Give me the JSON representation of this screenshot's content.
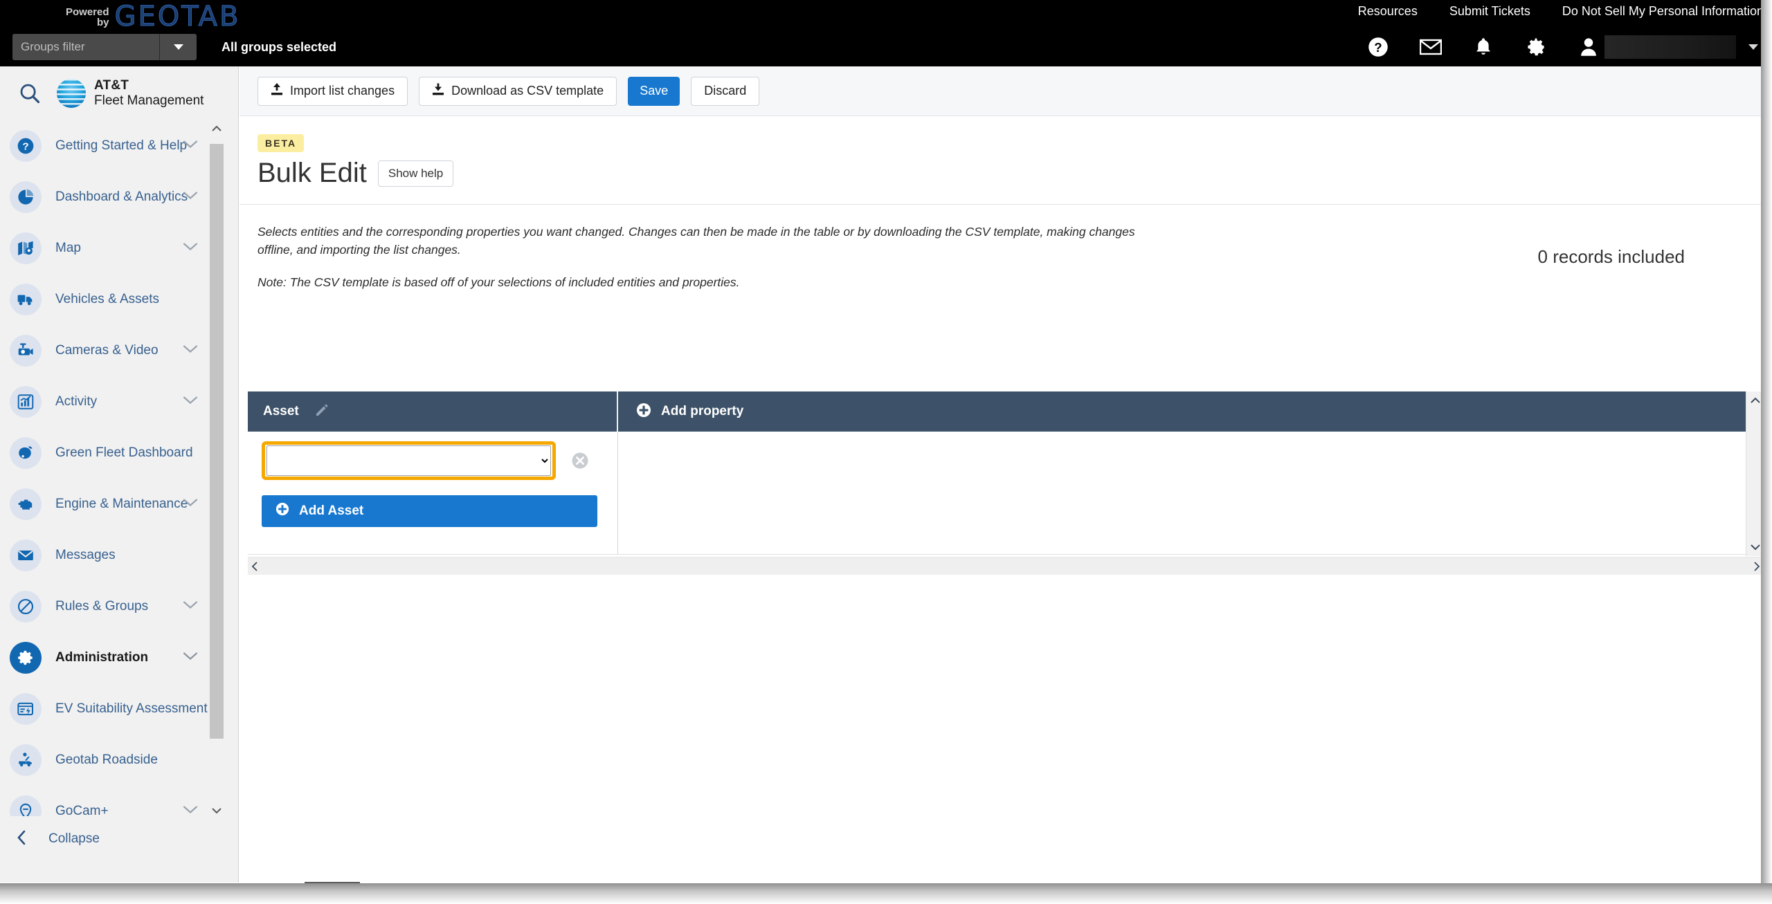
{
  "topbar": {
    "powered_line1": "Powered",
    "powered_line2": "by",
    "brand_word": "GEOTAB",
    "links": [
      {
        "label": "Resources",
        "name": "resources-link"
      },
      {
        "label": "Submit Tickets",
        "name": "submit-tickets-link"
      },
      {
        "label": "Do Not Sell My Personal Information",
        "name": "do-not-sell-link"
      }
    ],
    "groups_filter_placeholder": "Groups filter",
    "groups_filter_value": "",
    "all_groups_selected": "All groups selected",
    "icons": [
      "help-icon",
      "mail-icon",
      "bell-icon",
      "gear-icon",
      "user-icon"
    ]
  },
  "sidebar": {
    "brand_att": "AT&T",
    "brand_sub": "Fleet Management",
    "items": [
      {
        "label": "Getting Started & Help",
        "icon": "question-circle-icon",
        "chevron": true,
        "active": false
      },
      {
        "label": "Dashboard & Analytics",
        "icon": "pie-chart-icon",
        "chevron": true,
        "active": false
      },
      {
        "label": "Map",
        "icon": "map-pin-icon",
        "chevron": true,
        "active": false
      },
      {
        "label": "Vehicles & Assets",
        "icon": "truck-icon",
        "chevron": false,
        "active": false
      },
      {
        "label": "Cameras & Video",
        "icon": "dashcam-icon",
        "chevron": true,
        "active": false
      },
      {
        "label": "Activity",
        "icon": "bar-chart-icon",
        "chevron": true,
        "active": false
      },
      {
        "label": "Green Fleet Dashboard",
        "icon": "leaf-icon",
        "chevron": false,
        "active": false
      },
      {
        "label": "Engine & Maintenance",
        "icon": "engine-icon",
        "chevron": true,
        "active": false
      },
      {
        "label": "Messages",
        "icon": "envelope-icon",
        "chevron": false,
        "active": false
      },
      {
        "label": "Rules & Groups",
        "icon": "no-entry-icon",
        "chevron": true,
        "active": false
      },
      {
        "label": "Administration",
        "icon": "gear-icon",
        "chevron": true,
        "active": true
      },
      {
        "label": "EV Suitability Assessment",
        "icon": "ev-card-icon",
        "chevron": false,
        "active": false
      },
      {
        "label": "Geotab Roadside",
        "icon": "tow-truck-icon",
        "chevron": false,
        "active": false
      },
      {
        "label": "GoCam+",
        "icon": "location-pin-icon",
        "chevron": true,
        "active": false
      }
    ],
    "collapse_label": "Collapse"
  },
  "toolbar": {
    "import_label": "Import list changes",
    "download_label": "Download as CSV template",
    "save_label": "Save",
    "discard_label": "Discard"
  },
  "page": {
    "beta_badge": "BETA",
    "title": "Bulk Edit",
    "show_help_label": "Show help",
    "description": "Selects entities and the corresponding properties you want changed. Changes can then be made in the table or by downloading the CSV template, making changes offline, and importing the list changes.",
    "note": "Note: The CSV template is based off of your selections of included entities and properties.",
    "records_included": "0 records included"
  },
  "table": {
    "asset_column_header": "Asset",
    "edit_icon": "pencil-icon",
    "add_property_label": "Add property",
    "asset_select_value": "",
    "asset_select_options": [
      ""
    ],
    "remove_row_icon": "remove-circle-icon",
    "add_asset_label": "Add Asset"
  },
  "colors": {
    "accent_blue": "#1878cf",
    "focus_orange": "#f5a800",
    "table_header": "#3d5168",
    "sidebar_bg": "#f1f1f1",
    "beta_yellow": "#fbeea0",
    "nav_text": "#38618f"
  }
}
